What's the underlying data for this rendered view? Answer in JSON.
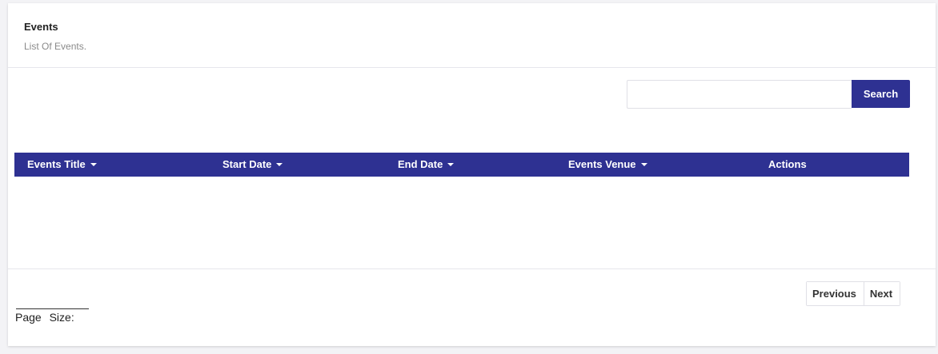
{
  "header": {
    "title": "Events",
    "subtitle": "List Of Events."
  },
  "search": {
    "value": "",
    "placeholder": "",
    "button_label": "Search"
  },
  "table": {
    "columns": [
      {
        "label": "Events Title",
        "sortable": true
      },
      {
        "label": "Start Date",
        "sortable": true
      },
      {
        "label": "End Date",
        "sortable": true
      },
      {
        "label": "Events Venue",
        "sortable": true
      },
      {
        "label": "Actions",
        "sortable": false
      }
    ],
    "rows": []
  },
  "pagination": {
    "previous_label": "Previous",
    "next_label": "Next"
  },
  "page_size": {
    "label": "Page Size:"
  },
  "colors": {
    "accent": "#2e3192",
    "background": "#f3f3f6",
    "card": "#ffffff"
  }
}
